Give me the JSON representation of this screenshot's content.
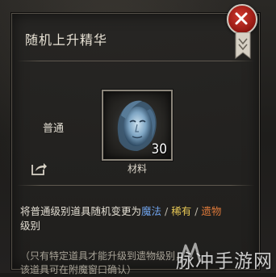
{
  "popup": {
    "title": "随机上升精华",
    "grade_label": "普通",
    "item": {
      "count": "30",
      "type_label": "材料",
      "icon": "blue-face-essence-icon"
    },
    "description": {
      "prefix": "将普通级别道具随机变更为",
      "magic": "魔法",
      "separator": " / ",
      "rare": "稀有",
      "relic": "遗物",
      "suffix": "级别"
    },
    "note_line1": "（只有特定道具才能升级到遗物级别，",
    "note_line2": "该道具可在附魔窗口确认）"
  },
  "colors": {
    "magic": "#6ea0e8",
    "rare": "#e6c655",
    "relic": "#e07a3a",
    "close_button": "#b82a20"
  },
  "icons": {
    "close": "close-icon",
    "share": "share-icon",
    "bookmark": "bookmark-icon"
  },
  "watermark": "脉冲手游网"
}
